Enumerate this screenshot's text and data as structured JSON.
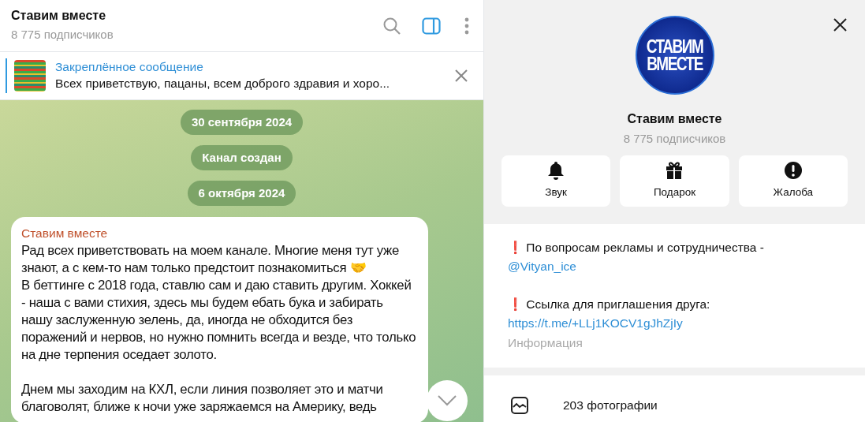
{
  "header": {
    "title": "Ставим вместе",
    "subtitle": "8 775 подписчиков",
    "sidebar_toggle": {
      "selected": true
    }
  },
  "pinned": {
    "label": "Закреплённое сообщение",
    "text": "Всех приветствую, пацаны, всем доброго здравия и хоро..."
  },
  "service_messages": [
    "30 сентября 2024",
    "Канал создан",
    "6 октября 2024"
  ],
  "message": {
    "author": "Ставим вместе",
    "paragraphs": [
      "Рад всех приветствовать на моем канале. Многие меня тут уже знают, а с кем-то нам только предстоит познакомиться 🤝\nВ беттинге с 2018 года, ставлю сам и даю ставить другим. Хоккей - наша с вами стихия, здесь мы будем ебать бука и забирать нашу заслуженную зелень, да, иногда не обходится без поражений и нервов, но нужно помнить всегда и везде, что только на дне терпения оседает золото.",
      "Днем мы заходим на КХЛ, если линия позволяет это и матчи благоволят, ближе к ночи уже заряжаемся на Америку, ведь"
    ]
  },
  "profile": {
    "logo_lines": [
      "СТАВИМ",
      "ВМЕСТЕ"
    ],
    "name": "Ставим вместе",
    "subtitle": "8 775 подписчиков",
    "actions": [
      {
        "kind": "bell",
        "label": "Звук"
      },
      {
        "kind": "gift",
        "label": "Подарок"
      },
      {
        "kind": "alert",
        "label": "Жалоба"
      }
    ],
    "info": [
      {
        "text": "❗ По вопросам рекламы и сотрудничества -",
        "link": "@Vityan_ice"
      },
      {
        "text": "❗ Ссылка для приглашения друга:",
        "link": "https://t.me/+LLj1KOCV1gJhZjIy"
      }
    ],
    "info_caption": "Информация",
    "media": [
      {
        "label": "203 фотографии"
      }
    ]
  }
}
